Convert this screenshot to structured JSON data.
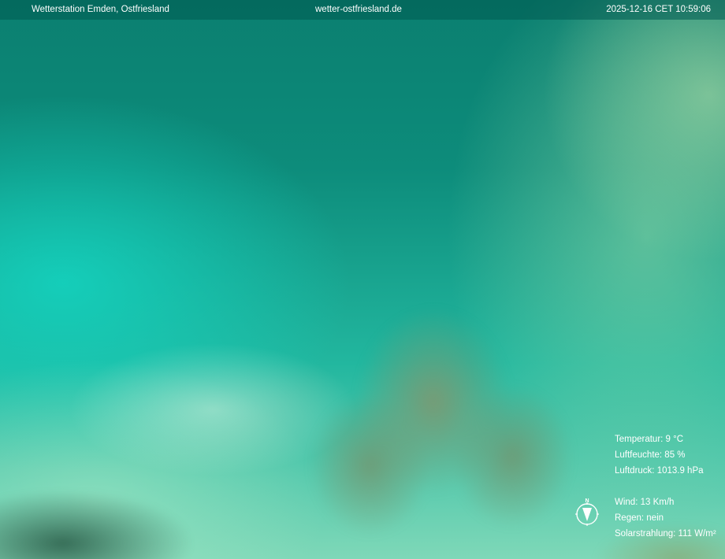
{
  "header": {
    "station_name": "Wetterstation Emden, Ostfriesland",
    "website": "wetter-ostfriesland.de",
    "timestamp": "2025-12-16 CET 10:59:06"
  },
  "weather": {
    "temperature": "Temperatur: 9 °C",
    "humidity": "Luftfeuchte: 85 %",
    "pressure": "Luftdruck: 1013.9 hPa",
    "wind": "Wind: 13 Km/h",
    "rain": "Regen: nein",
    "solar": "Solarstrahlung: 111 W/m²"
  },
  "compass": {
    "north_label": "N",
    "icon": "compass-icon"
  },
  "colors": {
    "sky_top": "#0b7f70",
    "sky_bottom": "#7fd8b8",
    "overlay_text": "#ffffff"
  }
}
